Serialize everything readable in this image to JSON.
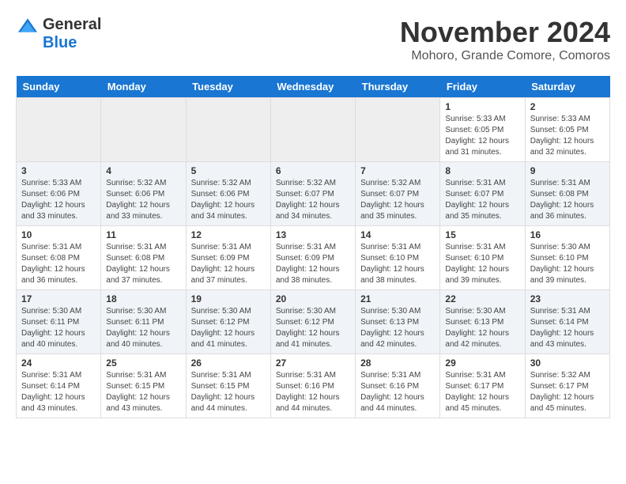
{
  "header": {
    "logo_general": "General",
    "logo_blue": "Blue",
    "month": "November 2024",
    "location": "Mohoro, Grande Comore, Comoros"
  },
  "days_of_week": [
    "Sunday",
    "Monday",
    "Tuesday",
    "Wednesday",
    "Thursday",
    "Friday",
    "Saturday"
  ],
  "weeks": [
    [
      {
        "day": "",
        "info": ""
      },
      {
        "day": "",
        "info": ""
      },
      {
        "day": "",
        "info": ""
      },
      {
        "day": "",
        "info": ""
      },
      {
        "day": "",
        "info": ""
      },
      {
        "day": "1",
        "info": "Sunrise: 5:33 AM\nSunset: 6:05 PM\nDaylight: 12 hours and 31 minutes."
      },
      {
        "day": "2",
        "info": "Sunrise: 5:33 AM\nSunset: 6:05 PM\nDaylight: 12 hours and 32 minutes."
      }
    ],
    [
      {
        "day": "3",
        "info": "Sunrise: 5:33 AM\nSunset: 6:06 PM\nDaylight: 12 hours and 33 minutes."
      },
      {
        "day": "4",
        "info": "Sunrise: 5:32 AM\nSunset: 6:06 PM\nDaylight: 12 hours and 33 minutes."
      },
      {
        "day": "5",
        "info": "Sunrise: 5:32 AM\nSunset: 6:06 PM\nDaylight: 12 hours and 34 minutes."
      },
      {
        "day": "6",
        "info": "Sunrise: 5:32 AM\nSunset: 6:07 PM\nDaylight: 12 hours and 34 minutes."
      },
      {
        "day": "7",
        "info": "Sunrise: 5:32 AM\nSunset: 6:07 PM\nDaylight: 12 hours and 35 minutes."
      },
      {
        "day": "8",
        "info": "Sunrise: 5:31 AM\nSunset: 6:07 PM\nDaylight: 12 hours and 35 minutes."
      },
      {
        "day": "9",
        "info": "Sunrise: 5:31 AM\nSunset: 6:08 PM\nDaylight: 12 hours and 36 minutes."
      }
    ],
    [
      {
        "day": "10",
        "info": "Sunrise: 5:31 AM\nSunset: 6:08 PM\nDaylight: 12 hours and 36 minutes."
      },
      {
        "day": "11",
        "info": "Sunrise: 5:31 AM\nSunset: 6:08 PM\nDaylight: 12 hours and 37 minutes."
      },
      {
        "day": "12",
        "info": "Sunrise: 5:31 AM\nSunset: 6:09 PM\nDaylight: 12 hours and 37 minutes."
      },
      {
        "day": "13",
        "info": "Sunrise: 5:31 AM\nSunset: 6:09 PM\nDaylight: 12 hours and 38 minutes."
      },
      {
        "day": "14",
        "info": "Sunrise: 5:31 AM\nSunset: 6:10 PM\nDaylight: 12 hours and 38 minutes."
      },
      {
        "day": "15",
        "info": "Sunrise: 5:31 AM\nSunset: 6:10 PM\nDaylight: 12 hours and 39 minutes."
      },
      {
        "day": "16",
        "info": "Sunrise: 5:30 AM\nSunset: 6:10 PM\nDaylight: 12 hours and 39 minutes."
      }
    ],
    [
      {
        "day": "17",
        "info": "Sunrise: 5:30 AM\nSunset: 6:11 PM\nDaylight: 12 hours and 40 minutes."
      },
      {
        "day": "18",
        "info": "Sunrise: 5:30 AM\nSunset: 6:11 PM\nDaylight: 12 hours and 40 minutes."
      },
      {
        "day": "19",
        "info": "Sunrise: 5:30 AM\nSunset: 6:12 PM\nDaylight: 12 hours and 41 minutes."
      },
      {
        "day": "20",
        "info": "Sunrise: 5:30 AM\nSunset: 6:12 PM\nDaylight: 12 hours and 41 minutes."
      },
      {
        "day": "21",
        "info": "Sunrise: 5:30 AM\nSunset: 6:13 PM\nDaylight: 12 hours and 42 minutes."
      },
      {
        "day": "22",
        "info": "Sunrise: 5:30 AM\nSunset: 6:13 PM\nDaylight: 12 hours and 42 minutes."
      },
      {
        "day": "23",
        "info": "Sunrise: 5:31 AM\nSunset: 6:14 PM\nDaylight: 12 hours and 43 minutes."
      }
    ],
    [
      {
        "day": "24",
        "info": "Sunrise: 5:31 AM\nSunset: 6:14 PM\nDaylight: 12 hours and 43 minutes."
      },
      {
        "day": "25",
        "info": "Sunrise: 5:31 AM\nSunset: 6:15 PM\nDaylight: 12 hours and 43 minutes."
      },
      {
        "day": "26",
        "info": "Sunrise: 5:31 AM\nSunset: 6:15 PM\nDaylight: 12 hours and 44 minutes."
      },
      {
        "day": "27",
        "info": "Sunrise: 5:31 AM\nSunset: 6:16 PM\nDaylight: 12 hours and 44 minutes."
      },
      {
        "day": "28",
        "info": "Sunrise: 5:31 AM\nSunset: 6:16 PM\nDaylight: 12 hours and 44 minutes."
      },
      {
        "day": "29",
        "info": "Sunrise: 5:31 AM\nSunset: 6:17 PM\nDaylight: 12 hours and 45 minutes."
      },
      {
        "day": "30",
        "info": "Sunrise: 5:32 AM\nSunset: 6:17 PM\nDaylight: 12 hours and 45 minutes."
      }
    ]
  ]
}
